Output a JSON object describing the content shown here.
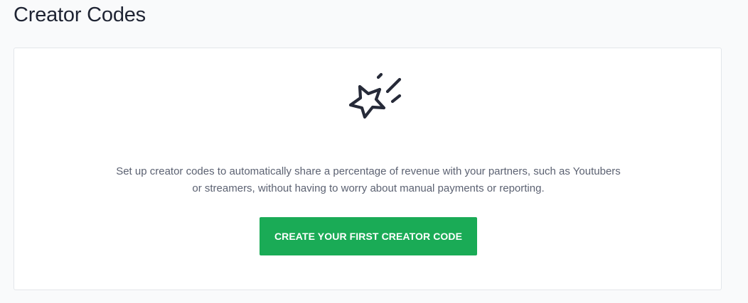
{
  "page": {
    "title": "Creator Codes"
  },
  "empty_state": {
    "icon": "shooting-star-icon",
    "description_line1": "Set up creator codes to automatically share a percentage of revenue with your partners, such as Youtubers",
    "description_line2": "or streamers, without having to worry about manual payments or reporting.",
    "cta_label": "CREATE YOUR FIRST CREATOR CODE"
  },
  "colors": {
    "accent": "#1aab56",
    "text_primary": "#1f2433",
    "text_secondary": "#5c6272",
    "background": "#f9fafb"
  }
}
